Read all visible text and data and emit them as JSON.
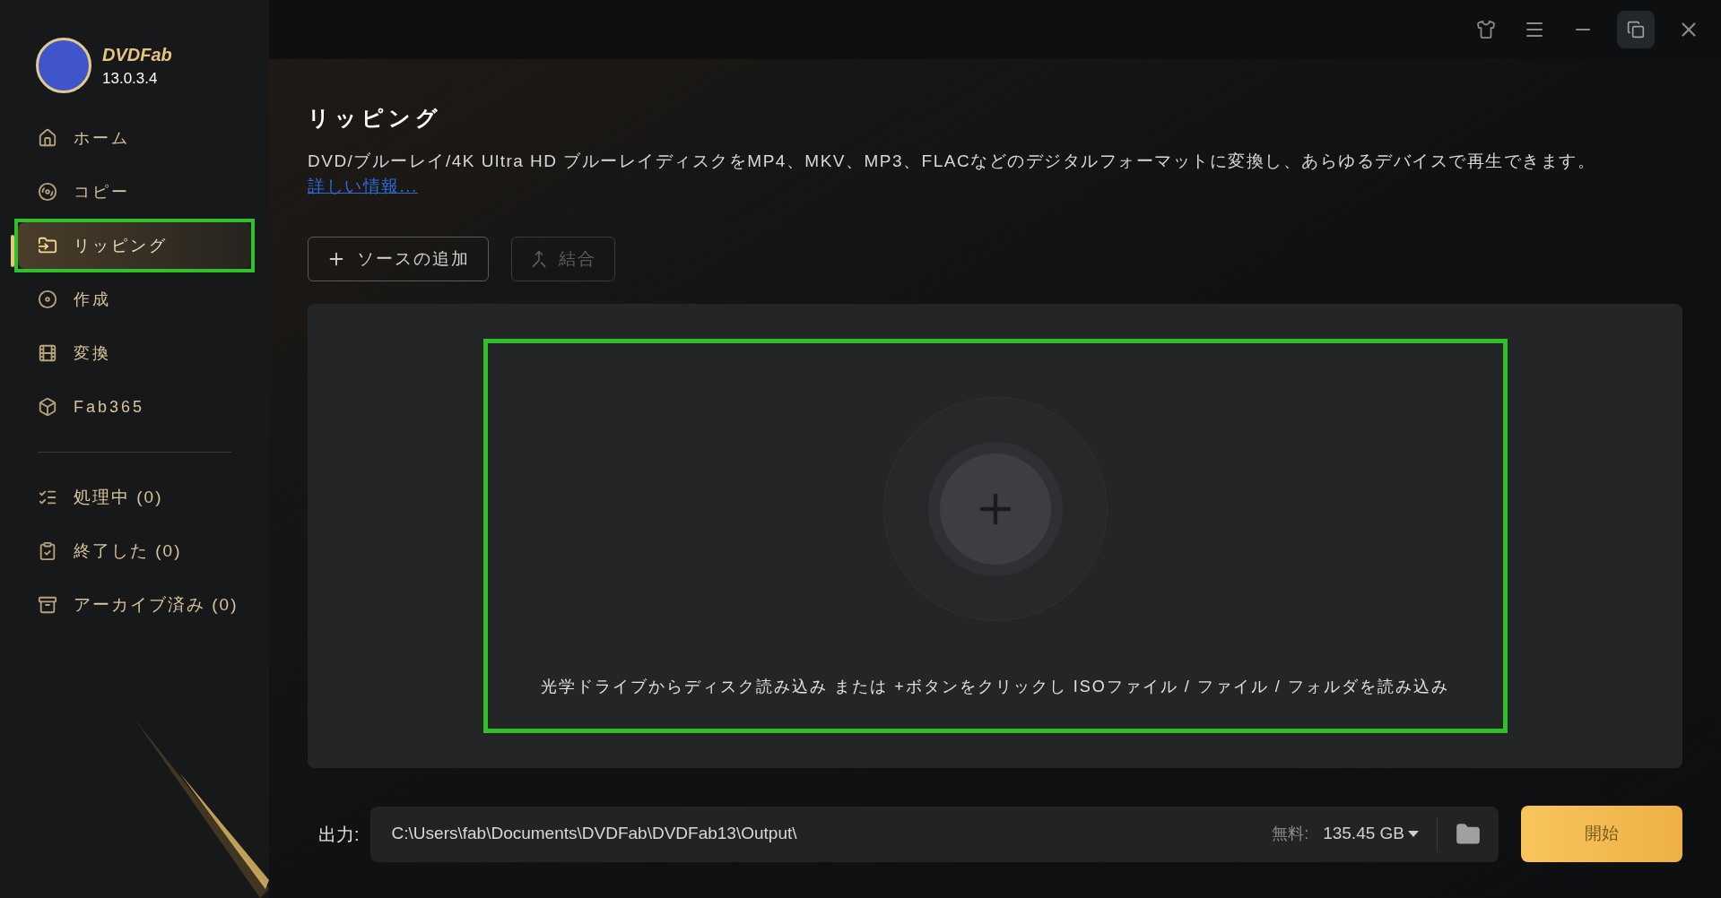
{
  "app": {
    "name": "DVDFab",
    "version": "13.0.3.4"
  },
  "nav": [
    {
      "label": "ホーム",
      "selected": false,
      "highlighted": false
    },
    {
      "label": "コピー",
      "selected": false,
      "highlighted": false
    },
    {
      "label": "リッピング",
      "selected": true,
      "highlighted": true
    },
    {
      "label": "作成",
      "selected": false,
      "highlighted": false
    },
    {
      "label": "変換",
      "selected": false,
      "highlighted": false
    },
    {
      "label": "Fab365",
      "selected": false,
      "highlighted": false
    }
  ],
  "queue": [
    {
      "label": "処理中 (0)"
    },
    {
      "label": "終了した (0)"
    },
    {
      "label": "アーカイブ済み (0)"
    }
  ],
  "page": {
    "title": "リッピング",
    "description": "DVD/ブルーレイ/4K Ultra HD ブルーレイディスクをMP4、MKV、MP3、FLACなどのデジタルフォーマットに変換し、あらゆるデバイスで再生できます。",
    "link": "詳しい情報..."
  },
  "toolbar": [
    {
      "label": "ソースの追加",
      "disabled": false
    },
    {
      "label": "結合",
      "disabled": true
    }
  ],
  "drop_area": {
    "hint": "光学ドライブからディスク読み込み または +ボタンをクリックし ISOファイル / ファイル / フォルダを読み込み",
    "highlighted": true
  },
  "output": {
    "label": "出力:",
    "path": "C:\\Users\\fab\\Documents\\DVDFab\\DVDFab13\\Output\\",
    "free_label": "無料:",
    "free_space": "135.45 GB",
    "start": "開始"
  }
}
